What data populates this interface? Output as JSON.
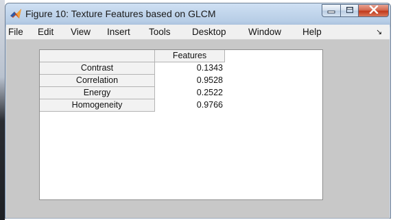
{
  "window": {
    "title": "Figure 10: Texture Features based on GLCM",
    "icon": "matlab-icon",
    "controls": {
      "minimize_icon": "minimize-icon",
      "maximize_icon": "maximize-icon",
      "close_icon": "close-icon"
    }
  },
  "menu": {
    "items": [
      "File",
      "Edit",
      "View",
      "Insert",
      "Tools",
      "Desktop",
      "Window",
      "Help"
    ],
    "overflow_icon": "toolbar-overflow-icon"
  },
  "table": {
    "column_headers": [
      "Features"
    ],
    "rows": [
      {
        "label": "Contrast",
        "value": "0.1343"
      },
      {
        "label": "Correlation",
        "value": "0.9528"
      },
      {
        "label": "Energy",
        "value": "0.2522"
      },
      {
        "label": "Homogeneity",
        "value": "0.9766"
      }
    ]
  },
  "colors": {
    "titlebar": "#b7cde6",
    "close_button": "#c23a1c",
    "canvas": "#c8c8c8"
  }
}
